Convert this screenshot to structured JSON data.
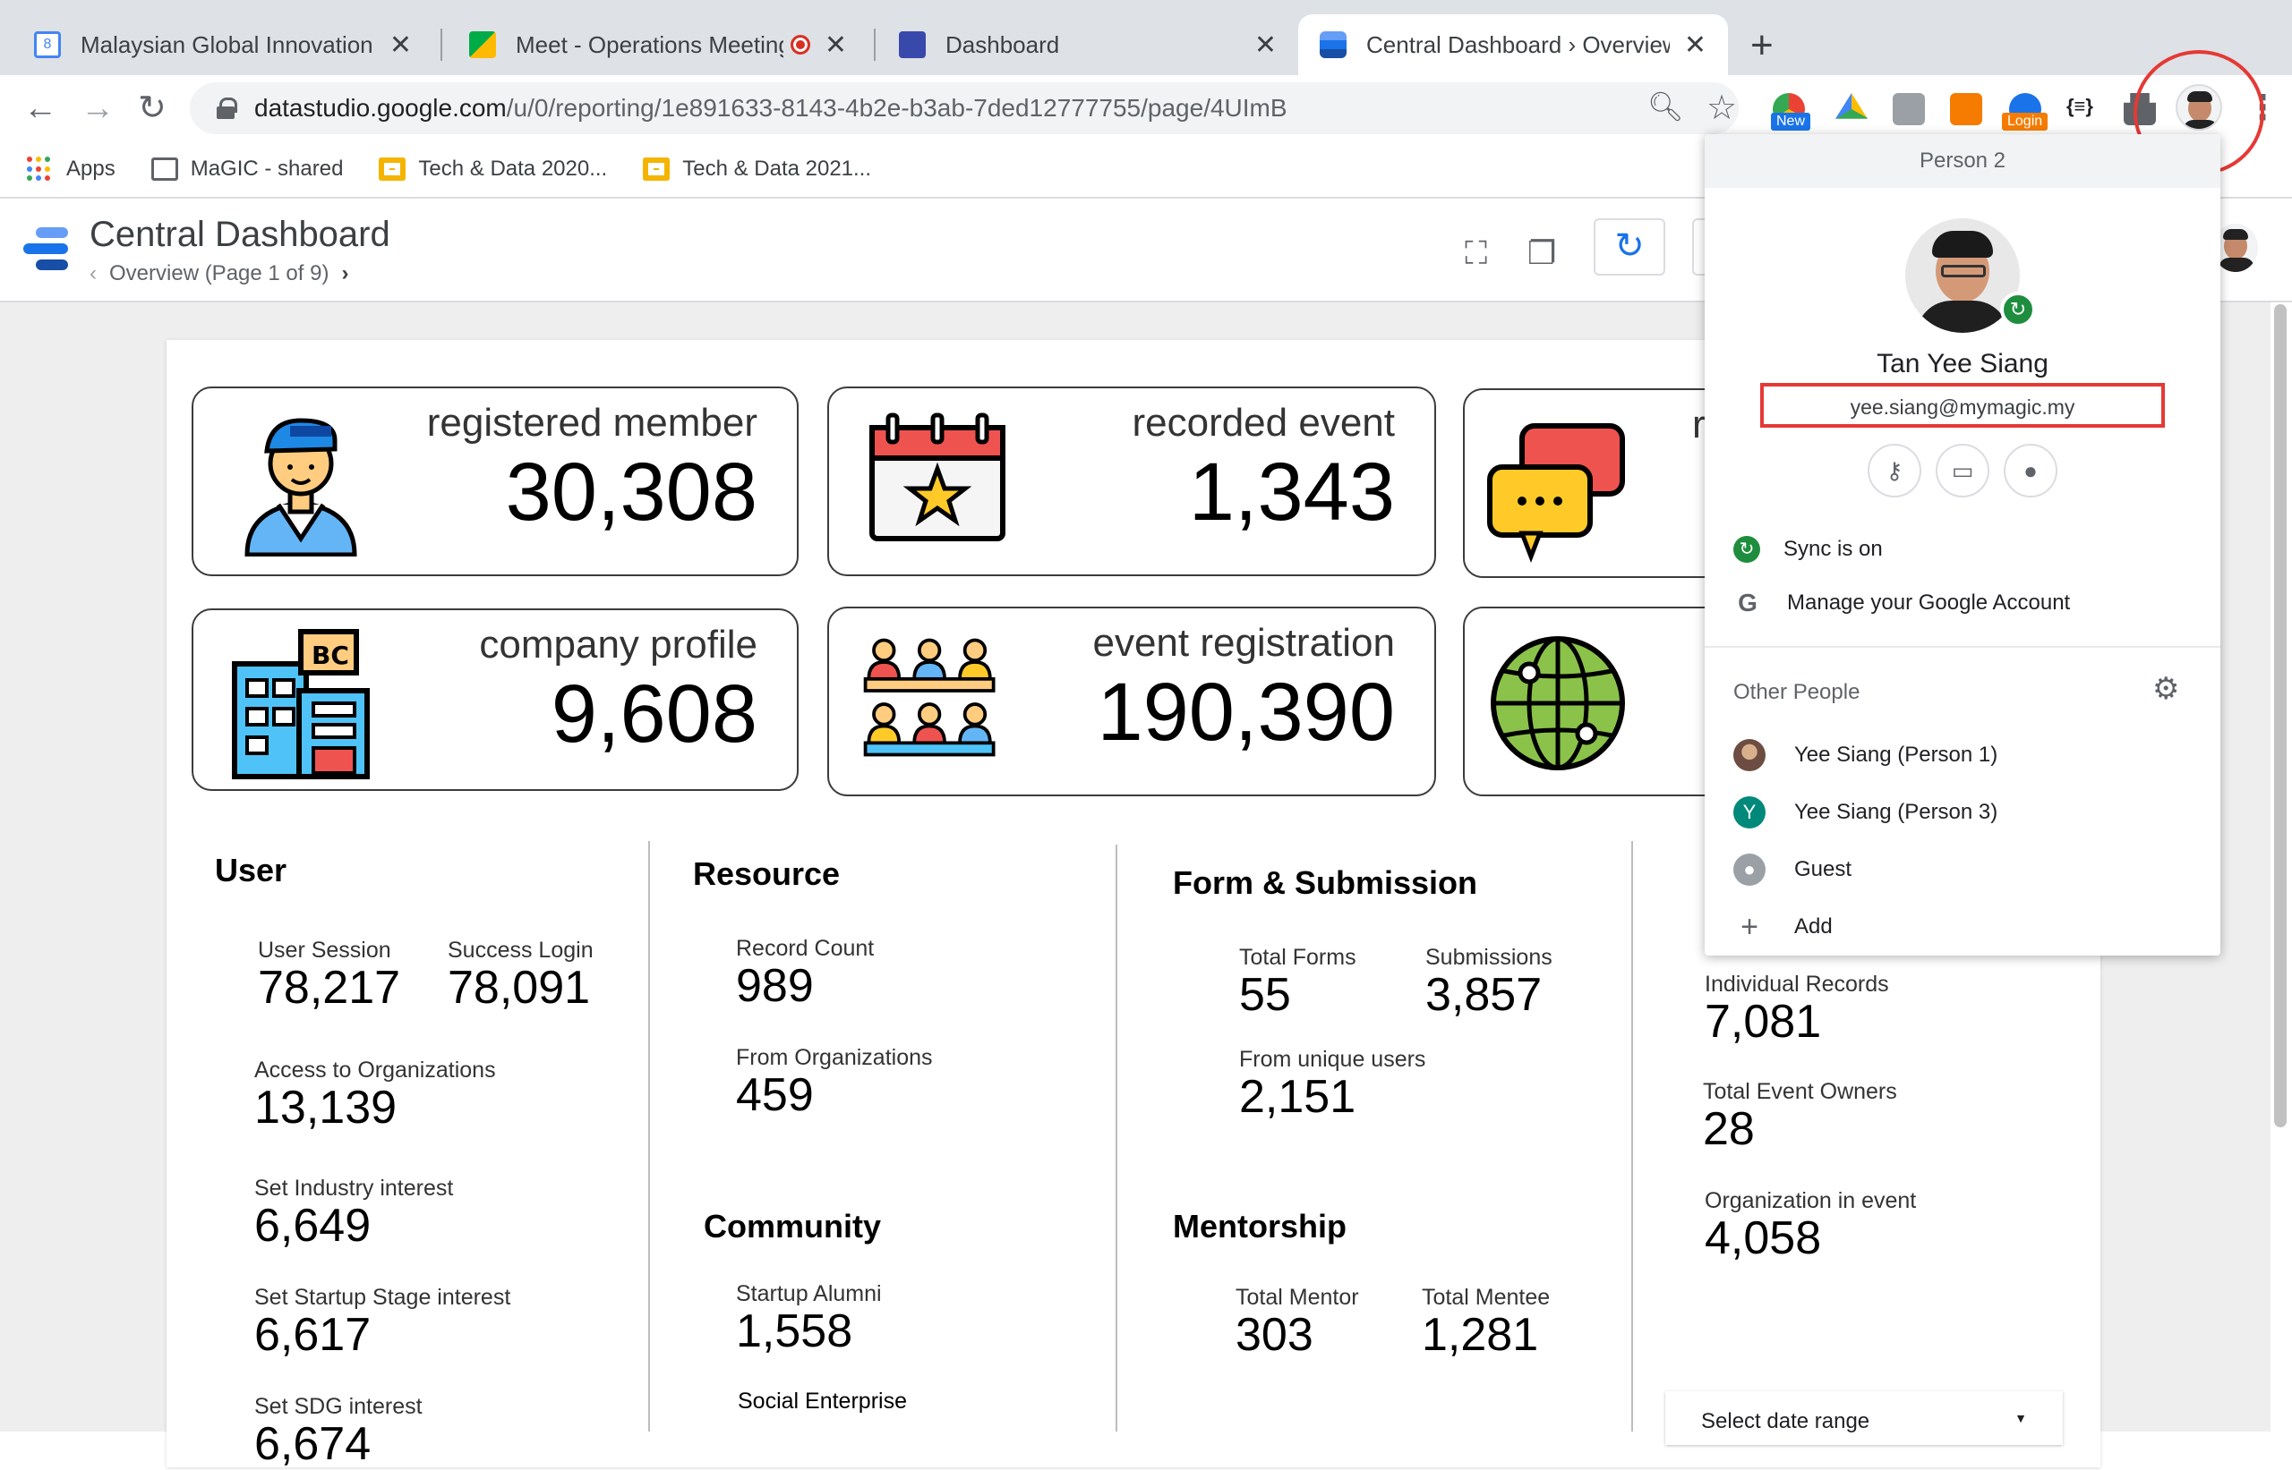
{
  "tabs": [
    {
      "title": "Malaysian Global Innovation & C",
      "icon": "calendar-icon",
      "active": false
    },
    {
      "title": "Meet - Operations Meeting",
      "icon": "meet-icon",
      "active": false
    },
    {
      "title": "Dashboard",
      "icon": "dashboard-icon",
      "active": false
    },
    {
      "title": "Central Dashboard › Overview",
      "icon": "datastudio-icon",
      "active": true
    }
  ],
  "toolbar": {
    "url_domain": "datastudio.google.com",
    "url_path": "/u/0/reporting/1e891633-8143-4b2e-b3ab-7ded12777755/page/4UImB",
    "ext_new_label": "New",
    "ext_login_label": "Login"
  },
  "bookmarks": [
    {
      "label": "Apps"
    },
    {
      "label": "MaGIC - shared"
    },
    {
      "label": "Tech & Data 2020..."
    },
    {
      "label": "Tech & Data 2021..."
    }
  ],
  "report": {
    "title": "Central Dashboard",
    "page": "Overview (Page 1 of 9)"
  },
  "kpis": [
    {
      "label": "registered member",
      "value": "30,308"
    },
    {
      "label": "recorded event",
      "value": "1,343"
    },
    {
      "label": "r",
      "value": ""
    },
    {
      "label": "company profile",
      "value": "9,608"
    },
    {
      "label": "event registration",
      "value": "190,390"
    }
  ],
  "sections": {
    "user": {
      "title": "User",
      "metrics": [
        {
          "label": "User Session",
          "value": "78,217"
        },
        {
          "label": "Success Login",
          "value": "78,091"
        },
        {
          "label": "Access to Organizations",
          "value": "13,139"
        },
        {
          "label": "Set Industry interest",
          "value": "6,649"
        },
        {
          "label": "Set Startup Stage interest",
          "value": "6,617"
        },
        {
          "label": "Set SDG interest",
          "value": "6,674"
        }
      ]
    },
    "resource": {
      "title": "Resource",
      "metrics": [
        {
          "label": "Record Count",
          "value": "989"
        },
        {
          "label": "From Organizations",
          "value": "459"
        }
      ]
    },
    "community": {
      "title": "Community",
      "metrics": [
        {
          "label": "Startup Alumni",
          "value": "1,558"
        },
        {
          "label": "Social Enterprise",
          "value": ""
        }
      ]
    },
    "form": {
      "title": "Form & Submission",
      "metrics": [
        {
          "label": "Total Forms",
          "value": "55"
        },
        {
          "label": "Submissions",
          "value": "3,857"
        },
        {
          "label": "From unique users",
          "value": "2,151"
        }
      ]
    },
    "mentorship": {
      "title": "Mentorship",
      "metrics": [
        {
          "label": "Total Mentor",
          "value": "303"
        },
        {
          "label": "Total Mentee",
          "value": "1,281"
        }
      ]
    },
    "event": {
      "metrics": [
        {
          "label": "Individual Records",
          "value": "7,081"
        },
        {
          "label": "Total Event Owners",
          "value": "28"
        },
        {
          "label": "Organization in event",
          "value": "4,058"
        }
      ]
    },
    "date_range": "Select date range"
  },
  "profile": {
    "header": "Person 2",
    "name": "Tan Yee Siang",
    "email": "yee.siang@mymagic.my",
    "sync_label": "Sync is on",
    "manage_label": "Manage your Google Account",
    "other_people_label": "Other People",
    "people": [
      {
        "label": "Yee Siang (Person 1)"
      },
      {
        "label": "Yee Siang (Person 3)",
        "initial": "Y"
      },
      {
        "label": "Guest"
      },
      {
        "label": "Add"
      }
    ]
  },
  "colors": {
    "accent_blue": "#1a73e8",
    "highlight_red": "#e53935",
    "sync_green": "#1e8e3e"
  }
}
